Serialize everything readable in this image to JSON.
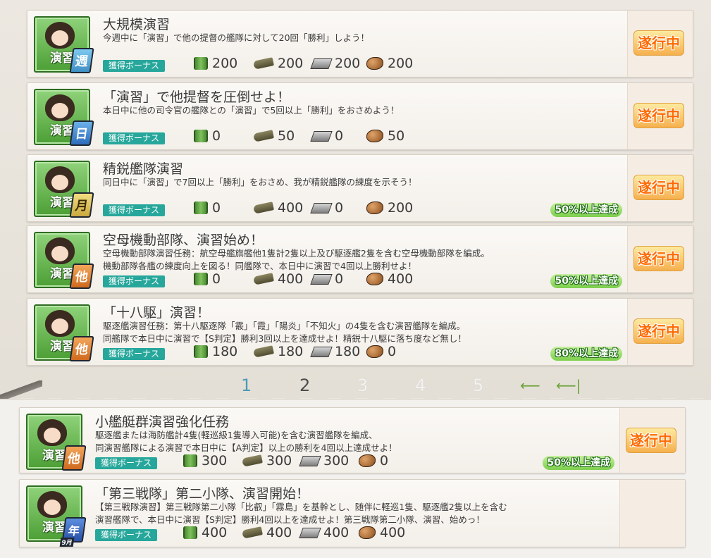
{
  "quests_top": [
    {
      "category": "演習",
      "frequency": "週",
      "title": "大規模演習",
      "desc": [
        "今週中に「演習」で他の提督の艦隊に対して20回「勝利」しよう！"
      ],
      "bonus_label": "獲得ボーナス",
      "resources": {
        "fuel": "200",
        "ammo": "200",
        "steel": "200",
        "bauxite": "200"
      },
      "status": "遂行中",
      "progress": ""
    },
    {
      "category": "演習",
      "frequency": "日",
      "title": "「演習」で他提督を圧倒せよ！",
      "desc": [
        "本日中に他の司令官の艦隊との「演習」で5回以上「勝利」をおさめよう！"
      ],
      "bonus_label": "獲得ボーナス",
      "resources": {
        "fuel": "0",
        "ammo": "50",
        "steel": "0",
        "bauxite": "50"
      },
      "status": "遂行中",
      "progress": ""
    },
    {
      "category": "演習",
      "frequency": "月",
      "title": "精鋭艦隊演習",
      "desc": [
        "同日中に「演習」で7回以上「勝利」をおさめ、我が精鋭艦隊の練度を示そう！"
      ],
      "bonus_label": "獲得ボーナス",
      "resources": {
        "fuel": "0",
        "ammo": "400",
        "steel": "0",
        "bauxite": "200"
      },
      "status": "遂行中",
      "progress": "50%以上達成"
    },
    {
      "category": "演習",
      "frequency": "他",
      "title": "空母機動部隊、演習始め！",
      "desc": [
        "空母機動部隊演習任務：航空母艦旗艦他1隻計2隻以上及び駆逐艦2隻を含む空母機動部隊を編成。",
        "機動部隊各艦の練度向上を図る！同艦隊で、本日中に演習で4回以上勝利せよ！"
      ],
      "bonus_label": "獲得ボーナス",
      "resources": {
        "fuel": "0",
        "ammo": "400",
        "steel": "0",
        "bauxite": "400"
      },
      "status": "遂行中",
      "progress": "50%以上達成"
    },
    {
      "category": "演習",
      "frequency": "他",
      "title": "「十八駆」演習！",
      "desc": [
        "駆逐艦演習任務：第十八駆逐隊「霰」「霞」「陽炎」「不知火」の4隻を含む演習艦隊を編成。",
        "同艦隊で本日中に演習で【S判定】勝利3回以上を達成せよ！精鋭十八駆に落ち度など無し！"
      ],
      "bonus_label": "獲得ボーナス",
      "resources": {
        "fuel": "180",
        "ammo": "180",
        "steel": "180",
        "bauxite": "0"
      },
      "status": "遂行中",
      "progress": "80%以上達成"
    }
  ],
  "pager": {
    "pages": [
      "1",
      "2",
      "3",
      "4",
      "5"
    ],
    "prev_arrow": "⟵",
    "last_arrow": "⟵|"
  },
  "quests_bottom": [
    {
      "category": "演習",
      "frequency": "他",
      "title": "小艦艇群演習強化任務",
      "desc": [
        "駆逐艦または海防艦計4隻(軽巡級1隻導入可能)を含む演習艦隊を編成、",
        "同演習艦隊による演習で本日中に【A判定】以上の勝利を4回以上達成せよ！"
      ],
      "bonus_label": "獲得ボーナス",
      "resources": {
        "fuel": "300",
        "ammo": "300",
        "steel": "300",
        "bauxite": "0"
      },
      "status": "遂行中",
      "progress": "50%以上達成"
    },
    {
      "category": "演習",
      "frequency": "年",
      "frequency_sub": "9月",
      "title": "「第三戦隊」第二小隊、演習開始！",
      "desc": [
        "【第三戦隊演習】第三戦隊第二小隊「比叡」「霧島」を基幹とし、随伴に軽巡1隻、駆逐艦2隻以上を含む",
        "演習艦隊で、本日中に演習【S判定】勝利4回以上を達成せよ！第三戦隊第二小隊、演習、始めっ！"
      ],
      "bonus_label": "獲得ボーナス",
      "resources": {
        "fuel": "400",
        "ammo": "400",
        "steel": "400",
        "bauxite": "400"
      },
      "status": "",
      "progress": ""
    }
  ]
}
